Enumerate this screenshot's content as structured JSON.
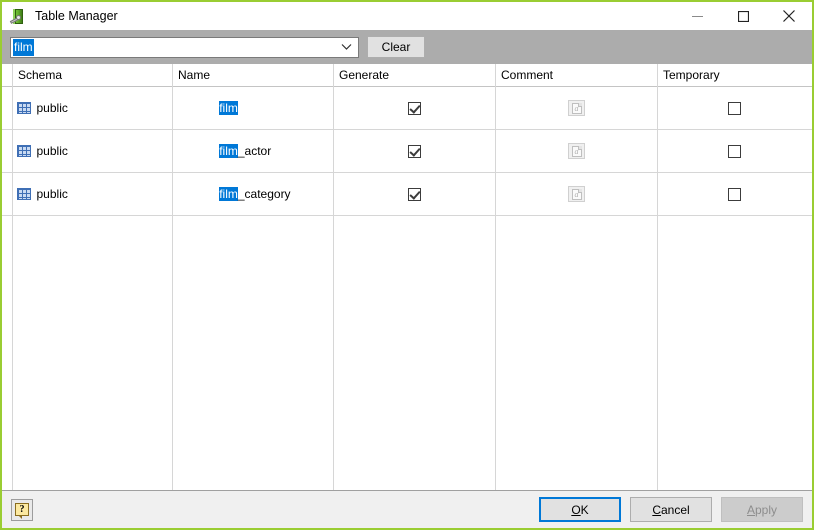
{
  "window": {
    "title": "Table Manager",
    "icon": "table-manager-icon",
    "accent_border": "#9ACD32",
    "controls": {
      "minimize": "minimize-icon",
      "maximize": "maximize-icon",
      "close": "close-icon"
    }
  },
  "toolbar": {
    "filter": {
      "value": "film",
      "selected": true,
      "placeholder": "",
      "dropdown_icon": "chevron-down-icon"
    },
    "clear_label": "Clear"
  },
  "grid": {
    "columns": [
      {
        "key": "schema",
        "label": "Schema"
      },
      {
        "key": "name",
        "label": "Name"
      },
      {
        "key": "generate",
        "label": "Generate"
      },
      {
        "key": "comment",
        "label": "Comment"
      },
      {
        "key": "temporary",
        "label": "Temporary"
      }
    ],
    "rows": [
      {
        "icon": "table-icon",
        "schema": "public",
        "name_highlight": "film",
        "name_rest": "",
        "generate": true,
        "comment_icon": "comment-document-icon",
        "temporary": false
      },
      {
        "icon": "table-icon",
        "schema": "public",
        "name_highlight": "film",
        "name_rest": "_actor",
        "generate": true,
        "comment_icon": "comment-document-icon",
        "temporary": false
      },
      {
        "icon": "table-icon",
        "schema": "public",
        "name_highlight": "film",
        "name_rest": "_category",
        "generate": true,
        "comment_icon": "comment-document-icon",
        "temporary": false
      }
    ],
    "highlight_color": "#0078D7"
  },
  "footer": {
    "help_label": "?",
    "help_icon": "help-balloon-icon",
    "buttons": {
      "ok": {
        "mnemonic": "O",
        "rest": "K",
        "state": "default"
      },
      "cancel": {
        "mnemonic": "C",
        "rest": "ancel",
        "state": "normal"
      },
      "apply": {
        "mnemonic": "A",
        "rest": "pply",
        "state": "disabled"
      }
    }
  }
}
